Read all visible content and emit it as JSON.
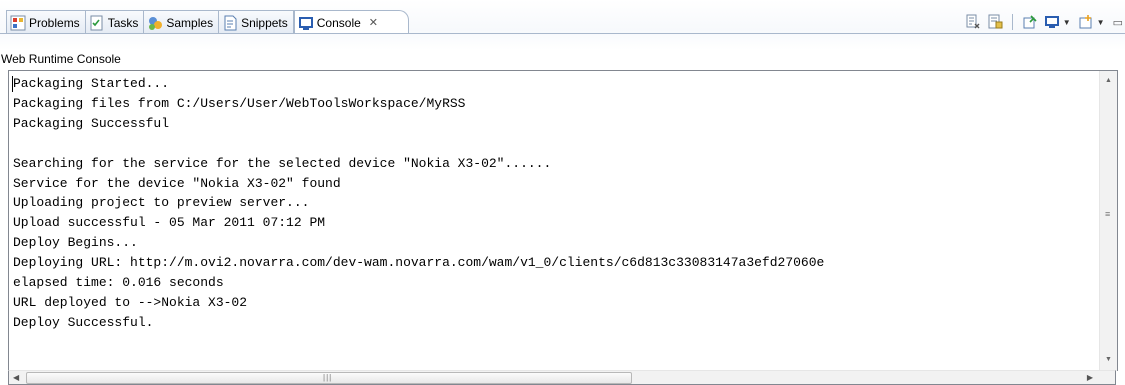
{
  "tabs": [
    {
      "label": "Problems",
      "icon": "problems-icon",
      "active": false
    },
    {
      "label": "Tasks",
      "icon": "tasks-icon",
      "active": false
    },
    {
      "label": "Samples",
      "icon": "samples-icon",
      "active": false
    },
    {
      "label": "Snippets",
      "icon": "snippets-icon",
      "active": false
    },
    {
      "label": "Console",
      "icon": "console-icon",
      "active": true
    }
  ],
  "console_title": "Web Runtime Console",
  "console_lines": [
    "Packaging Started...",
    "Packaging files from C:/Users/User/WebToolsWorkspace/MyRSS",
    "Packaging Successful",
    "",
    "Searching for the service for the selected device \"Nokia X3-02\"......",
    "Service for the device \"Nokia X3-02\" found",
    "Uploading project to preview server...",
    "Upload successful - 05 Mar 2011 07:12 PM",
    "Deploy Begins...",
    "Deploying URL: http://m.ovi2.novarra.com/dev-wam.novarra.com/wam/v1_0/clients/c6d813c33083147a3efd27060e",
    "elapsed time: 0.016 seconds",
    "URL deployed to -->Nokia X3-02",
    "Deploy Successful."
  ],
  "toolbar_icons": [
    "clear-console-icon",
    "scroll-lock-icon",
    "pin-console-icon",
    "display-selected-console-icon",
    "open-console-icon"
  ],
  "colors": {
    "tab_border": "#a9b8cc",
    "console_border": "#828790"
  }
}
